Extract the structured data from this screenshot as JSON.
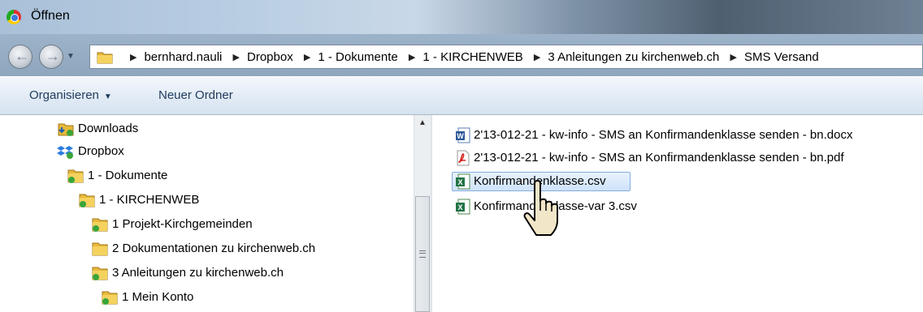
{
  "window": {
    "title": "Öffnen"
  },
  "address": {
    "crumbs": [
      "bernhard.nauli",
      "Dropbox",
      "1 - Dokumente",
      "1 - KIRCHENWEB",
      "3 Anleitungen zu kirchenweb.ch",
      "SMS Versand"
    ]
  },
  "toolbar": {
    "organize_label": "Organisieren",
    "new_folder_label": "Neuer Ordner"
  },
  "nav_tree": [
    {
      "label": "Downloads",
      "icon": "downloads-folder-icon"
    },
    {
      "label": "Dropbox",
      "icon": "dropbox-icon"
    },
    {
      "label": "1 - Dokumente",
      "icon": "folder-icon"
    },
    {
      "label": "1 - KIRCHENWEB",
      "icon": "folder-icon"
    },
    {
      "label": "1 Projekt-Kirchgemeinden",
      "icon": "folder-icon"
    },
    {
      "label": "2 Dokumentationen zu kirchenweb.ch",
      "icon": "folder-icon"
    },
    {
      "label": "3 Anleitungen zu kirchenweb.ch",
      "icon": "folder-icon"
    },
    {
      "label": "1 Mein Konto",
      "icon": "folder-icon"
    }
  ],
  "files": [
    {
      "name": "2'13-012-21 - kw-info - SMS an Konfirmandenklasse senden - bn.docx",
      "icon": "word-icon"
    },
    {
      "name": "2'13-012-21 - kw-info - SMS an Konfirmandenklasse senden - bn.pdf",
      "icon": "pdf-icon"
    },
    {
      "name": "Konfirmandenklasse.csv",
      "icon": "excel-icon",
      "selected": true
    },
    {
      "name": "Konfirmandenklasse-var 3.csv",
      "icon": "excel-icon"
    }
  ],
  "colors": {
    "selection": "#cfe3fa",
    "toolbar_text": "#1f3a5c",
    "folder": "#e8b93a",
    "sync_check": "#3aa53a"
  }
}
